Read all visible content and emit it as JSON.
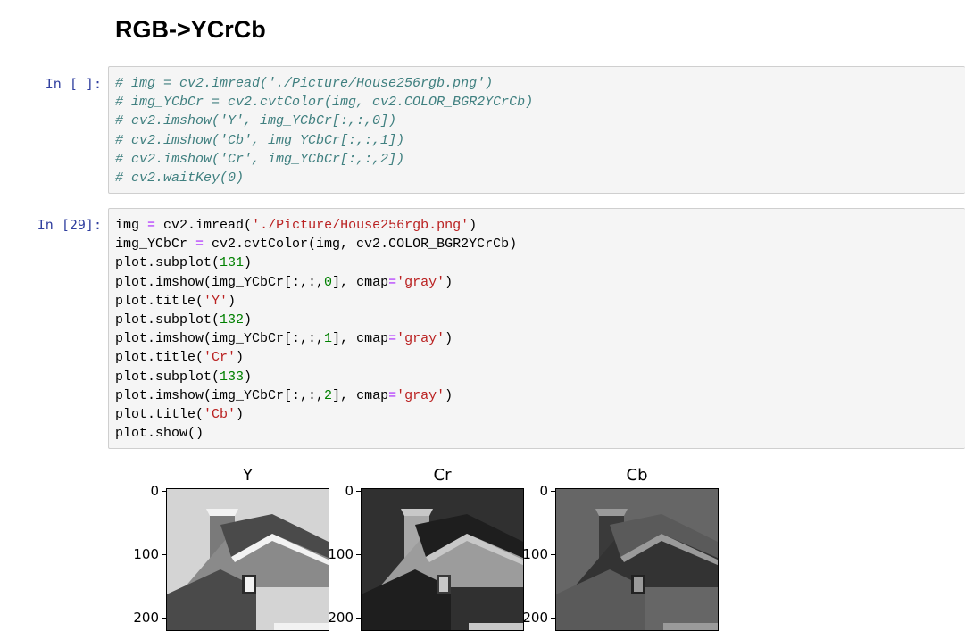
{
  "heading": "RGB->YCrCb",
  "cells": [
    {
      "prompt": "In [ ]:",
      "lines": [
        "# img = cv2.imread('./Picture/House256rgb.png')",
        "# img_YCbCr = cv2.cvtColor(img, cv2.COLOR_BGR2YCrCb)",
        "# cv2.imshow('Y', img_YCbCr[:,:,0])",
        "# cv2.imshow('Cb', img_YCbCr[:,:,1])",
        "# cv2.imshow('Cr', img_YCbCr[:,:,2])",
        "# cv2.waitKey(0)"
      ]
    },
    {
      "prompt": "In [29]:",
      "lines": [
        "img = cv2.imread('./Picture/House256rgb.png')",
        "img_YCbCr = cv2.cvtColor(img, cv2.COLOR_BGR2YCrCb)",
        "plot.subplot(131)",
        "plot.imshow(img_YCbCr[:,:,0], cmap='gray')",
        "plot.title('Y')",
        "plot.subplot(132)",
        "plot.imshow(img_YCbCr[:,:,1], cmap='gray')",
        "plot.title('Cr')",
        "plot.subplot(133)",
        "plot.imshow(img_YCbCr[:,:,2], cmap='gray')",
        "plot.title('Cb')",
        "plot.show()"
      ]
    }
  ],
  "output_plots": [
    {
      "title": "Y",
      "yticks": [
        "0",
        "100",
        "200"
      ],
      "palette": {
        "sky": "#d4d4d4",
        "wall": "#8a8a8a",
        "roof": "#4a4a4a",
        "trim": "#f2f2f2",
        "window": "#2a2a2a",
        "chimney": "#7a7a7a"
      }
    },
    {
      "title": "Cr",
      "yticks": [
        "0",
        "100",
        "200"
      ],
      "palette": {
        "sky": "#303030",
        "wall": "#9c9c9c",
        "roof": "#1e1e1e",
        "trim": "#c8c8c8",
        "window": "#3a3a3a",
        "chimney": "#a8a8a8"
      }
    },
    {
      "title": "Cb",
      "yticks": [
        "0",
        "100",
        "200"
      ],
      "palette": {
        "sky": "#666666",
        "wall": "#333333",
        "roof": "#5a5a5a",
        "trim": "#9a9a9a",
        "window": "#222222",
        "chimney": "#3a3a3a"
      }
    }
  ]
}
